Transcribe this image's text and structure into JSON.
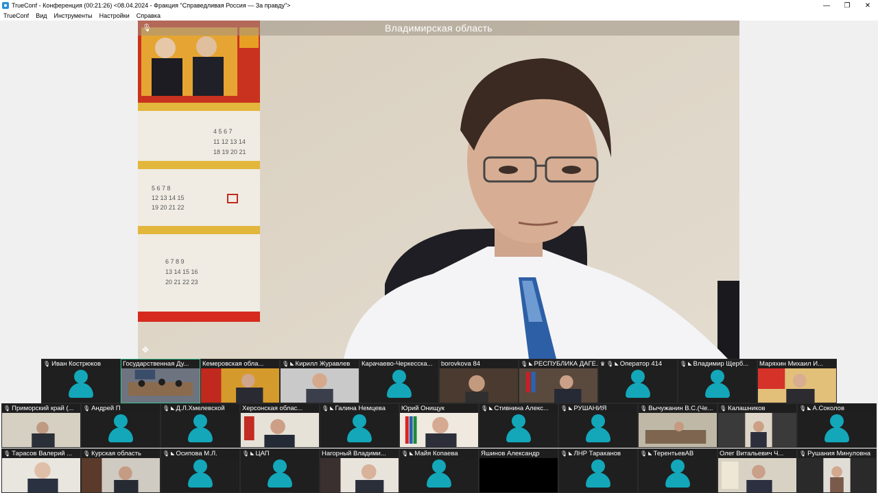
{
  "window": {
    "title": "TrueConf - Конференция (00:21:26) <08.04.2024 - Фракция \"Справедливая Россия — За правду\">",
    "controls": {
      "minimize": "—",
      "maximize": "❐",
      "close": "✕"
    }
  },
  "menu": [
    "TrueConf",
    "Вид",
    "Инструменты",
    "Настройки",
    "Справка"
  ],
  "main_video": {
    "caption": "Владимирская область"
  },
  "colors": {
    "avatar": "#13a7b9",
    "active_border": "#35c08d",
    "tile_bg": "#1f1f1f"
  },
  "participants": [
    {
      "name": "Иван Кострюков",
      "video": false,
      "mic": true,
      "cam": false
    },
    {
      "name": "Государственная Ду...",
      "video": true,
      "mic": false,
      "cam": false,
      "active": true,
      "scene": "room"
    },
    {
      "name": "Кемеровская обла...",
      "video": true,
      "mic": false,
      "cam": false,
      "scene": "orange"
    },
    {
      "name": "Кирилл Журавлев",
      "video": true,
      "mic": true,
      "cam": true,
      "scene": "man-light"
    },
    {
      "name": "Карачаево-Черкесска...",
      "video": false,
      "mic": false,
      "cam": false
    },
    {
      "name": "borovkova 84",
      "video": true,
      "mic": false,
      "cam": false,
      "scene": "dark"
    },
    {
      "name": "РЕСПУБЛИКА ДАГЕ...",
      "video": true,
      "mic": true,
      "cam": true,
      "scene": "flags"
    },
    {
      "name": "Оператор 414",
      "video": false,
      "mic": true,
      "cam": true,
      "crown": true
    },
    {
      "name": "Владимир Щерб...",
      "video": false,
      "mic": true,
      "cam": true
    },
    {
      "name": "Маряхин Михаил И...",
      "video": true,
      "mic": false,
      "cam": false,
      "scene": "orange-man"
    },
    {
      "name": "Приморский край (...",
      "video": true,
      "mic": true,
      "cam": false,
      "scene": "office"
    },
    {
      "name": "Андрей П",
      "video": false,
      "mic": true,
      "cam": false
    },
    {
      "name": "Д.Л.Хмелевской",
      "video": false,
      "mic": true,
      "cam": true
    },
    {
      "name": "Херсонская облас...",
      "video": true,
      "mic": false,
      "cam": false,
      "scene": "man-office"
    },
    {
      "name": "Галина Немцева",
      "video": false,
      "mic": true,
      "cam": true
    },
    {
      "name": "Юрий Онищук",
      "video": true,
      "mic": false,
      "cam": false,
      "scene": "flags-man"
    },
    {
      "name": "Стивнина Алекс...",
      "video": false,
      "mic": true,
      "cam": true
    },
    {
      "name": "РУШАНИЯ",
      "video": false,
      "mic": true,
      "cam": true
    },
    {
      "name": "Вычужанин В.С.(Че...",
      "video": true,
      "mic": true,
      "cam": false,
      "scene": "desk"
    },
    {
      "name": "Калашников",
      "video": true,
      "mic": true,
      "cam": false,
      "scene": "man-small"
    },
    {
      "name": "А.Соколов",
      "video": false,
      "mic": true,
      "cam": true
    },
    {
      "name": "Тарасов Валерий ...",
      "video": true,
      "mic": true,
      "cam": false,
      "scene": "elder"
    },
    {
      "name": "Курская область",
      "video": true,
      "mic": true,
      "cam": false,
      "scene": "man-dark"
    },
    {
      "name": "Осипова М.Л.",
      "video": false,
      "mic": true,
      "cam": true
    },
    {
      "name": "ЦАП",
      "video": false,
      "mic": true,
      "cam": true
    },
    {
      "name": "Нагорный Владими...",
      "video": true,
      "mic": false,
      "cam": false,
      "scene": "bald"
    },
    {
      "name": "Майя Копаева",
      "video": false,
      "mic": true,
      "cam": true
    },
    {
      "name": "Яшинов Александр",
      "video": false,
      "mic": false,
      "cam": false,
      "blank": true
    },
    {
      "name": "ЛНР Тараканов",
      "video": false,
      "mic": true,
      "cam": true
    },
    {
      "name": "ТерентьевАВ",
      "video": false,
      "mic": true,
      "cam": true
    },
    {
      "name": "Олег Витальевич Ч...",
      "video": true,
      "mic": false,
      "cam": false,
      "scene": "man-window"
    },
    {
      "name": "Рушания Минуловна",
      "video": true,
      "mic": true,
      "cam": false,
      "scene": "woman"
    }
  ]
}
